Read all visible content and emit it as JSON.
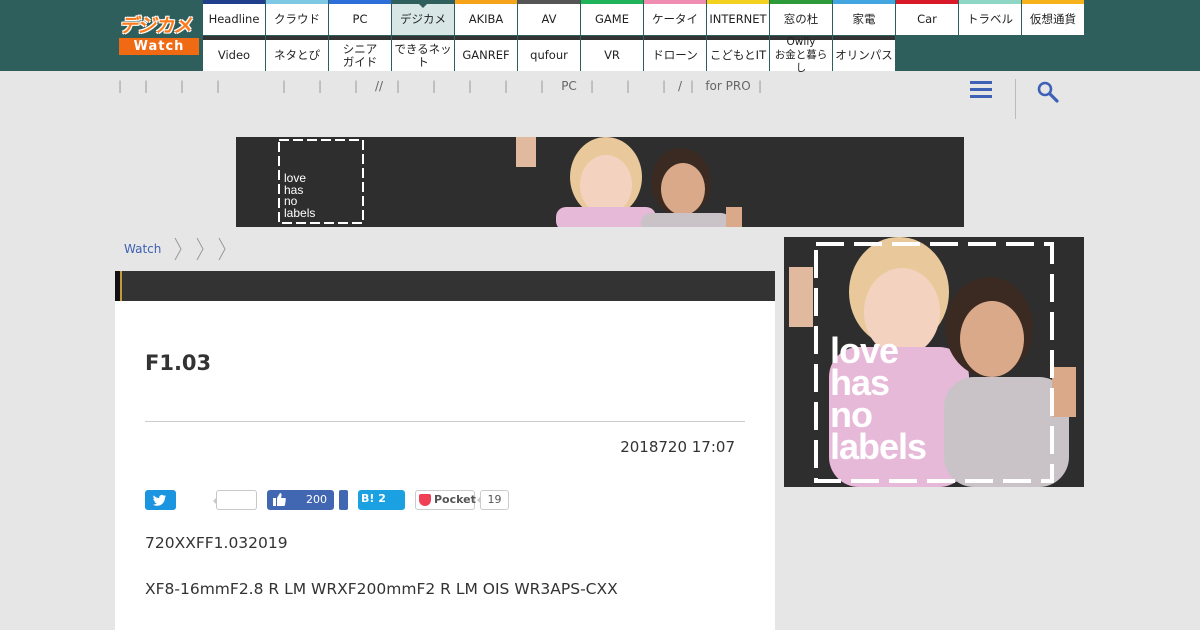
{
  "logo": {
    "top": "デジカメ",
    "bottom": "Watch"
  },
  "nav": {
    "row1": [
      {
        "label": "Headline",
        "color": "#1f3f8c"
      },
      {
        "label": "クラウド",
        "color": "#7ec8e3"
      },
      {
        "label": "PC",
        "color": "#2d6fd8"
      },
      {
        "label": "デジカメ",
        "color": "#2f5f5c",
        "active": true
      },
      {
        "label": "AKIBA",
        "color": "#f6a21a"
      },
      {
        "label": "AV",
        "color": "#555555"
      },
      {
        "label": "GAME",
        "color": "#1fb35a"
      },
      {
        "label": "ケータイ",
        "color": "#f28db2"
      },
      {
        "label": "INTERNET",
        "color": "#f2d21f"
      },
      {
        "label": "窓の杜",
        "color": "#2e9b3a"
      },
      {
        "label": "家電",
        "color": "#44a6e0"
      },
      {
        "label": "Car",
        "color": "#d9182a"
      },
      {
        "label": "トラベル",
        "color": "#8fd6c6"
      },
      {
        "label": "仮想通貨",
        "color": "#f6b21a"
      }
    ],
    "row2": [
      {
        "label": "Video"
      },
      {
        "label": "ネタとぴ"
      },
      {
        "label": "シニア\nガイド"
      },
      {
        "label": "できるネット"
      },
      {
        "label": "GANREF"
      },
      {
        "label": "qufour"
      },
      {
        "label": "VR"
      },
      {
        "label": "ドローン"
      },
      {
        "label": "こどもとIT"
      },
      {
        "label": "Owlly\nお金と暮らし"
      },
      {
        "label": "オリンパス"
      }
    ]
  },
  "subnav": {
    "items": [
      "",
      "",
      "",
      "",
      "",
      "",
      "//",
      "",
      "",
      "",
      "",
      "PC",
      "",
      "",
      "/",
      "for PRO"
    ],
    "separator": "|"
  },
  "icons": {
    "menu": "menu-list-icon",
    "search": "search-icon"
  },
  "ad_banner": {
    "text": "love\nhas\nno\nlabels"
  },
  "ad_side": {
    "text": "love\nhas\nno\nlabels"
  },
  "breadcrumb": {
    "home": "Watch"
  },
  "article": {
    "title": "F1.03",
    "date": "2018720 17:07",
    "share": {
      "facebook_count": "200",
      "hatena_label": "B! 2",
      "pocket_label": "Pocket",
      "pocket_count": "19"
    },
    "paragraphs": [
      "720XXFF1.032019",
      "XF8-16mmF2.8 R LM WRXF200mmF2 R LM OIS WR3APS-CXX"
    ]
  },
  "colors": {
    "header_bg": "#2f5f5c",
    "link": "#3e60b5",
    "logo_orange": "#f06a14"
  }
}
